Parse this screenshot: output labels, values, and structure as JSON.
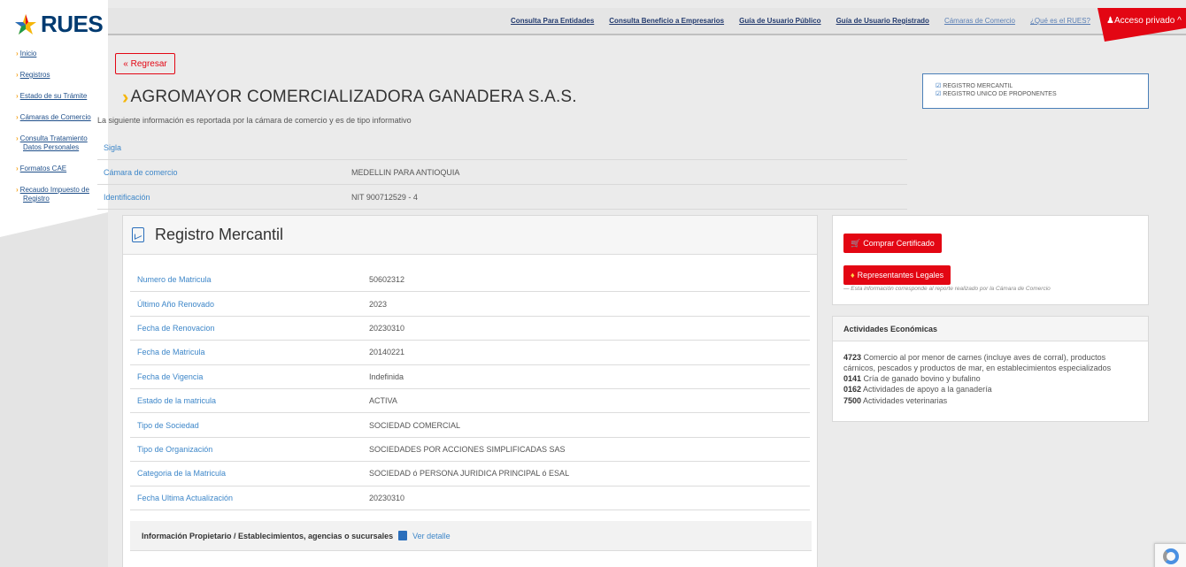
{
  "logo": {
    "text": "RUES"
  },
  "sidebar": {
    "items": [
      {
        "label": "Inicio"
      },
      {
        "label": "Registros"
      },
      {
        "label": "Estado de su Trámite"
      },
      {
        "label": "Cámaras de Comercio"
      },
      {
        "label": "Consulta Tratamiento Datos Personales"
      },
      {
        "label": "Formatos CAE"
      },
      {
        "label": "Recaudo Impuesto de Registro"
      }
    ]
  },
  "topnav": {
    "links": [
      {
        "label": "Consulta Para Entidades"
      },
      {
        "label": "Consulta Beneficio a Empresarios"
      },
      {
        "label": "Guía de Usuario Público"
      },
      {
        "label": "Guía de Usuario Registrado"
      },
      {
        "label": "Cámaras de Comercio"
      },
      {
        "label": "¿Qué es el RUES?"
      }
    ],
    "acceso": "Acceso privado"
  },
  "regresar": "« Regresar",
  "company": {
    "name": "AGROMAYOR COMERCIALIZADORA GANADERA S.A.S."
  },
  "registros": [
    "REGISTRO MERCANTIL",
    "REGISTRO UNICO DE PROPONENTES"
  ],
  "info_text": "La siguiente información es reportada por la cámara de comercio y es de tipo informativo",
  "basic": [
    {
      "k": "Sigla",
      "v": ""
    },
    {
      "k": "Cámara de comercio",
      "v": "MEDELLIN PARA ANTIOQUIA"
    },
    {
      "k": "Identificación",
      "v": "NIT 900712529 - 4"
    }
  ],
  "panel": {
    "title": "Registro Mercantil",
    "rows": [
      {
        "k": "Numero de Matricula",
        "v": "50602312"
      },
      {
        "k": "Último Año Renovado",
        "v": "2023"
      },
      {
        "k": "Fecha de Renovacion",
        "v": "20230310"
      },
      {
        "k": "Fecha de Matricula",
        "v": "20140221"
      },
      {
        "k": "Fecha de Vigencia",
        "v": "Indefinida"
      },
      {
        "k": "Estado de la matricula",
        "v": "ACTIVA"
      },
      {
        "k": "Tipo de Sociedad",
        "v": "SOCIEDAD COMERCIAL"
      },
      {
        "k": "Tipo de Organización",
        "v": "SOCIEDADES POR ACCIONES SIMPLIFICADAS SAS"
      },
      {
        "k": "Categoria de la Matricula",
        "v": "SOCIEDAD ó PERSONA JURIDICA PRINCIPAL ó ESAL"
      },
      {
        "k": "Fecha Ultima Actualización",
        "v": "20230310"
      }
    ],
    "owner_label": "Información Propietario / Establecimientos, agencias o sucursales",
    "ver_detalle": "Ver detalle"
  },
  "actions": {
    "comprar": "Comprar Certificado",
    "representantes": "Representantes Legales",
    "disclaimer": "— Esta información corresponde al reporte realizado por la Cámara de Comercio"
  },
  "actividades": {
    "title": "Actividades Económicas",
    "items": [
      {
        "code": "4723",
        "desc": "Comercio al por menor de carnes (incluye aves de corral), productos cárnicos, pescados y productos de mar, en establecimientos especializados"
      },
      {
        "code": "0141",
        "desc": "Cría de ganado bovino y bufalino"
      },
      {
        "code": "0162",
        "desc": "Actividades de apoyo a la ganadería"
      },
      {
        "code": "7500",
        "desc": "Actividades veterinarias"
      }
    ]
  },
  "colors": {
    "accent_red": "#e30613",
    "link_blue": "#3e87c9",
    "brand_navy": "#003a70",
    "chevron_yellow": "#f5b60a"
  }
}
